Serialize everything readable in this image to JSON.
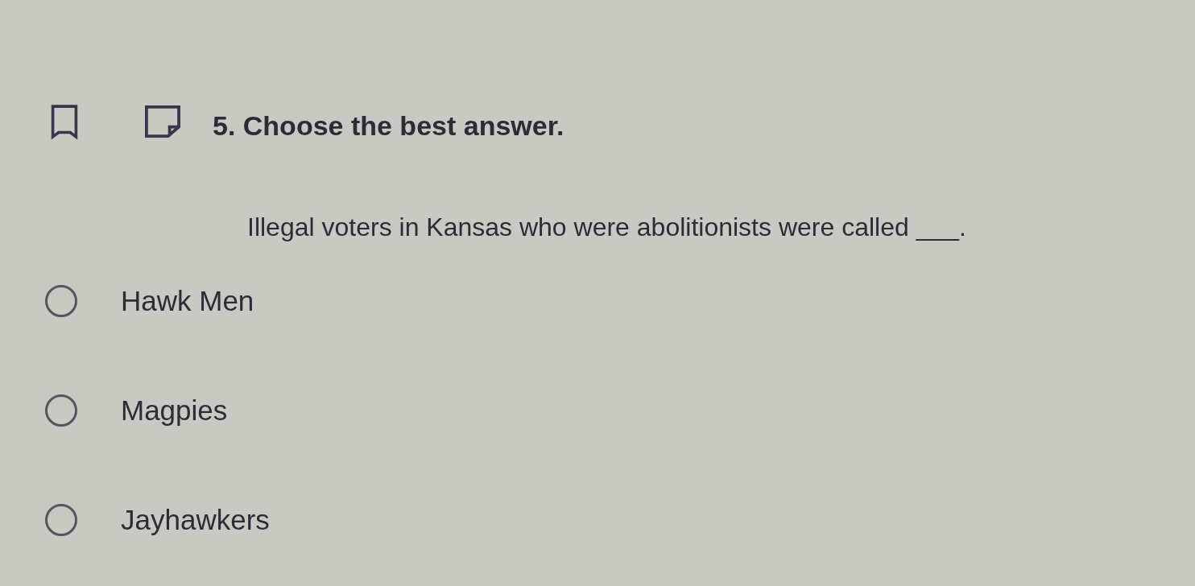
{
  "question": {
    "title": "5. Choose the best answer.",
    "bookmarked": false,
    "prompt": "Illegal voters in Kansas who were abolitionists were called ___."
  },
  "options": [
    {
      "label": "Hawk Men",
      "selected": false
    },
    {
      "label": "Magpies",
      "selected": false
    },
    {
      "label": "Jayhawkers",
      "selected": false
    }
  ]
}
